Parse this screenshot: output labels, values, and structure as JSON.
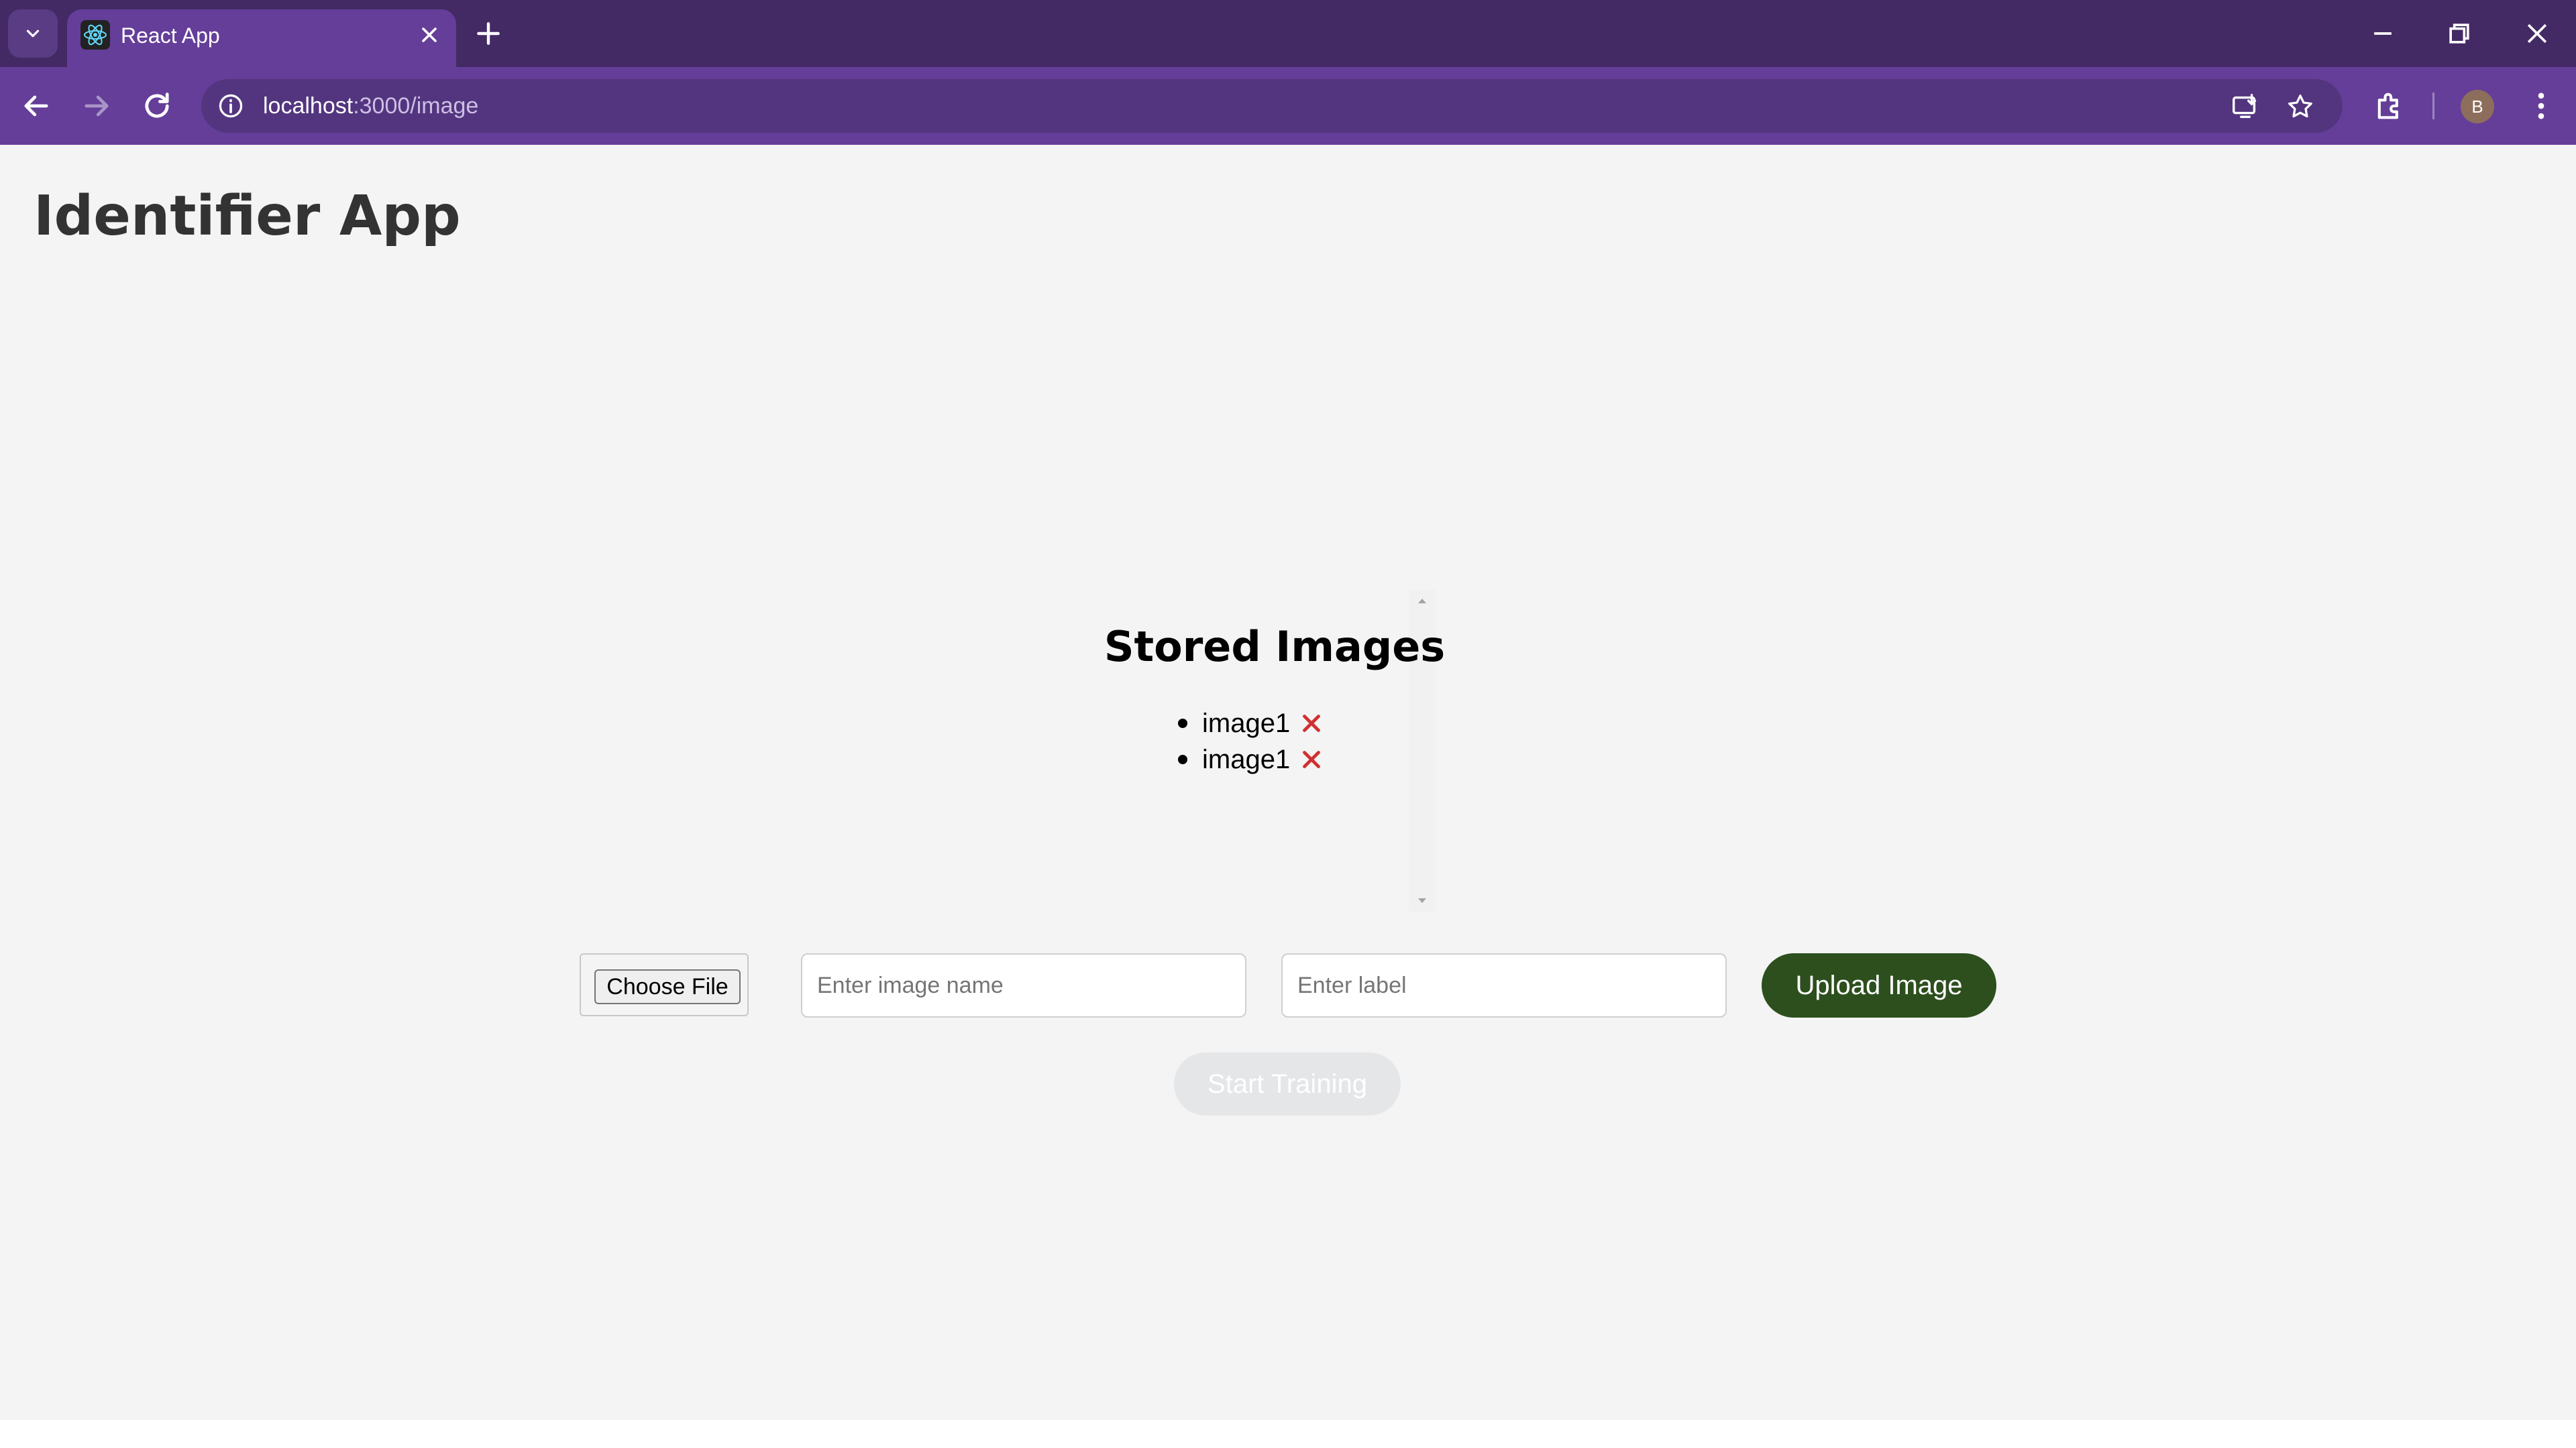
{
  "browser": {
    "tab_title": "React App",
    "url_host": "localhost",
    "url_path": ":3000/image",
    "profile_initial": "B"
  },
  "app": {
    "title": "Identifier App"
  },
  "stored_images": {
    "title": "Stored Images",
    "items": [
      {
        "name": "image1"
      },
      {
        "name": "image1"
      }
    ]
  },
  "form": {
    "choose_file_label": "Choose File",
    "image_name_placeholder": "Enter image name",
    "label_placeholder": "Enter label",
    "upload_label": "Upload Image",
    "train_label": "Start Training"
  },
  "colors": {
    "tabstrip": "#432a64",
    "toolbar": "#653e99",
    "upload_button": "#2d4f1e",
    "delete_icon": "#d32f2f",
    "disabled_button": "#e5e6e8"
  }
}
